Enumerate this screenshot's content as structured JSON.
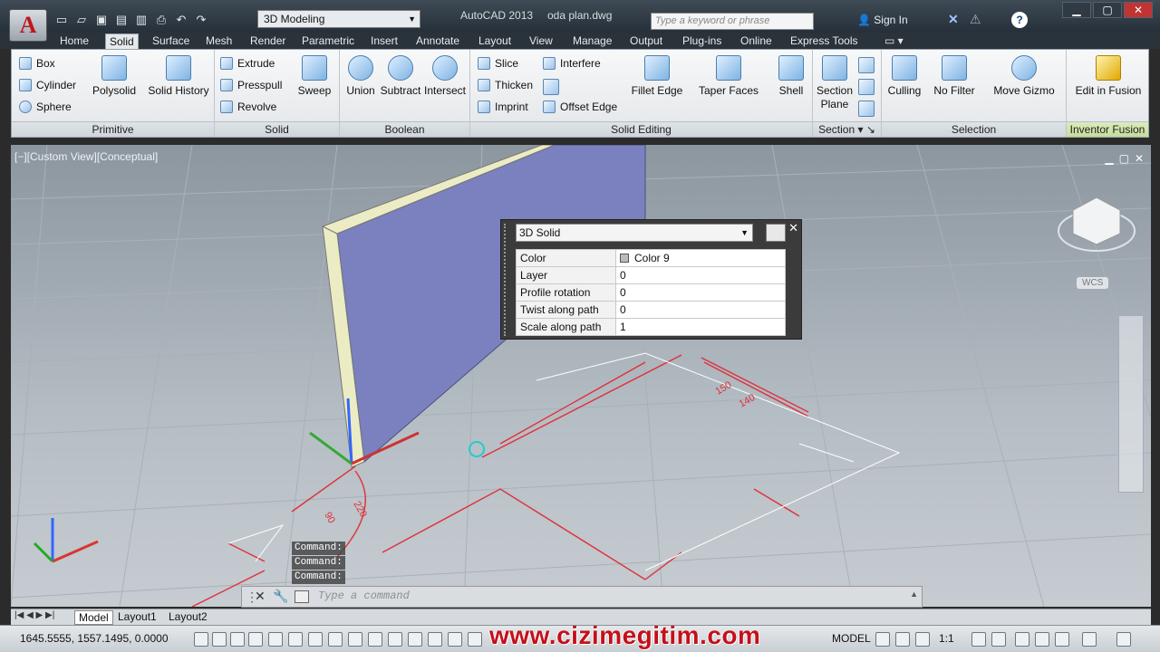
{
  "titlebar": {
    "app_letter": "A",
    "workspace": "3D Modeling",
    "app_title": "AutoCAD 2013",
    "file_name": "oda plan.dwg",
    "search_placeholder": "Type a keyword or phrase",
    "sign_in": "Sign In",
    "help_label": "?"
  },
  "tabs": [
    "Home",
    "Solid",
    "Surface",
    "Mesh",
    "Render",
    "Parametric",
    "Insert",
    "Annotate",
    "Layout",
    "View",
    "Manage",
    "Output",
    "Plug-ins",
    "Online",
    "Express Tools"
  ],
  "active_tab": "Solid",
  "ribbon": {
    "primitive": {
      "title": "Primitive",
      "box": "Box",
      "cylinder": "Cylinder",
      "sphere": "Sphere",
      "polysolid": "Polysolid",
      "solid_history": "Solid History"
    },
    "solid": {
      "title": "Solid",
      "extrude": "Extrude",
      "presspull": "Presspull",
      "revolve": "Revolve",
      "sweep": "Sweep"
    },
    "boolean": {
      "title": "Boolean",
      "union": "Union",
      "subtract": "Subtract",
      "intersect": "Intersect"
    },
    "solid_editing": {
      "title": "Solid Editing",
      "slice": "Slice",
      "thicken": "Thicken",
      "imprint": "Imprint",
      "interfere": "Interfere",
      "offset_edge": "Offset Edge",
      "fillet_edge": "Fillet Edge",
      "taper_faces": "Taper Faces",
      "shell": "Shell"
    },
    "section": {
      "title": "Section",
      "section_plane_1": "Section",
      "section_plane_2": "Plane"
    },
    "selection": {
      "title": "Selection",
      "culling": "Culling",
      "no_filter": "No Filter",
      "move_gizmo": "Move Gizmo"
    },
    "inventor": {
      "title": "Inventor Fusion",
      "edit": "Edit in Fusion"
    }
  },
  "viewport": {
    "label": "[−][Custom View][Conceptual]",
    "wcs": "WCS",
    "dims": [
      "150",
      "140",
      "220",
      "90"
    ]
  },
  "properties_panel": {
    "object_type": "3D Solid",
    "rows": [
      {
        "key": "Color",
        "value": "Color 9"
      },
      {
        "key": "Layer",
        "value": "0"
      },
      {
        "key": "Profile rotation",
        "value": "0"
      },
      {
        "key": "Twist along path",
        "value": "0"
      },
      {
        "key": "Scale along path",
        "value": "1"
      }
    ]
  },
  "command": {
    "history": [
      "Command:",
      "Command:",
      "Command:"
    ],
    "placeholder": "Type a command"
  },
  "layout_tabs": [
    "Model",
    "Layout1",
    "Layout2"
  ],
  "status": {
    "coordinates": "1645.5555, 1557.1495, 0.0000",
    "model": "MODEL",
    "scale": "1:1"
  },
  "watermark": "www.cizimegitim.com",
  "colors": {
    "accent_red": "#e0141e",
    "solid_face": "#7a7fbf",
    "solid_edge": "#eeeec8"
  }
}
